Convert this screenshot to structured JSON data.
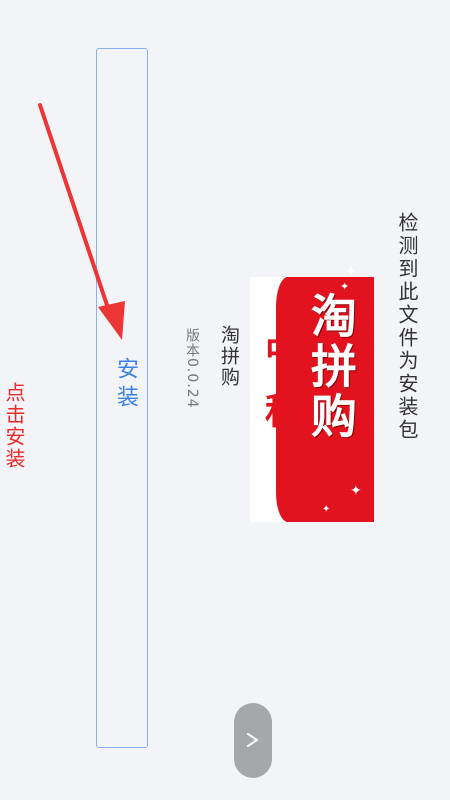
{
  "dialog": {
    "detect_text": "检测到此文件为安装包",
    "app_name": "淘拼购",
    "version": "版本0.0.24",
    "install_label": "安装",
    "hint_text": "点击安装"
  },
  "app_icon": {
    "logo_text": "淘拼购",
    "mid_text": "中秋",
    "colors": {
      "primary": "#e2131f",
      "background": "#ffffff"
    }
  },
  "icons": {
    "expand": "chevron-icon",
    "arrow": "red-arrow-annotation"
  },
  "colors": {
    "accent": "#3a82e6",
    "hint": "#ec2a2a",
    "page_background": "#f3f4f8"
  }
}
